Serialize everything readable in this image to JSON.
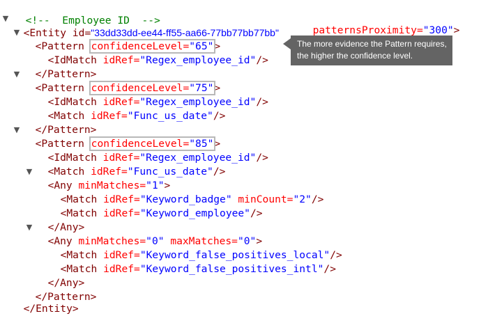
{
  "comment": "<!--  Employee ID  -->",
  "entity": {
    "open_prefix": "<Entity id=",
    "id_value": "\"33dd33dd-ee44-ff55-aa66-77bb77bb77bb\"",
    "proximity_attr": "patternsProximity=",
    "proximity_value": "\"300\"",
    "close": "</Entity>"
  },
  "tooltip": {
    "line1": "The more evidence the Pattern requires,",
    "line2": "the higher the confidence level."
  },
  "patterns": [
    {
      "open_tag": "<Pattern ",
      "conf_attr": "confidenceLevel=",
      "conf_value": "\"65\"",
      "open_close": ">",
      "lines": [
        {
          "tag": "<IdMatch ",
          "attr": "idRef=",
          "value": "\"Regex_employee_id\"",
          "end": "/>"
        }
      ],
      "close": "</Pattern>"
    },
    {
      "open_tag": "<Pattern ",
      "conf_attr": "confidenceLevel=",
      "conf_value": "\"75\"",
      "open_close": ">",
      "lines": [
        {
          "tag": "<IdMatch ",
          "attr": "idRef=",
          "value": "\"Regex_employee_id\"",
          "end": "/>"
        },
        {
          "tag": "<Match ",
          "attr": "idRef=",
          "value": "\"Func_us_date\"",
          "end": "/>"
        }
      ],
      "close": "</Pattern>"
    },
    {
      "open_tag": "<Pattern ",
      "conf_attr": "confidenceLevel=",
      "conf_value": "\"85\"",
      "open_close": ">",
      "lines": [
        {
          "tag": "<IdMatch ",
          "attr": "idRef=",
          "value": "\"Regex_employee_id\"",
          "end": "/>"
        },
        {
          "tag": "<Match ",
          "attr": "idRef=",
          "value": "\"Func_us_date\"",
          "end": "/>"
        }
      ],
      "any_blocks": [
        {
          "open_tag": "<Any ",
          "attr": "minMatches=",
          "value": "\"1\"",
          "attr2": "",
          "value2": "",
          "open_close": ">",
          "matches": [
            {
              "tag": "<Match ",
              "attr": "idRef=",
              "value": "\"Keyword_badge\"",
              "attr2": " minCount=",
              "value2": "\"2\"",
              "end": "/>"
            },
            {
              "tag": "<Match ",
              "attr": "idRef=",
              "value": "\"Keyword_employee\"",
              "attr2": "",
              "value2": "",
              "end": "/>"
            }
          ],
          "close": "</Any>"
        },
        {
          "open_tag": "<Any ",
          "attr": "minMatches=",
          "value": "\"0\"",
          "attr2": " maxMatches=",
          "value2": "\"0\"",
          "open_close": ">",
          "matches": [
            {
              "tag": "<Match ",
              "attr": "idRef=",
              "value": "\"Keyword_false_positives_local\"",
              "attr2": "",
              "value2": "",
              "end": "/>"
            },
            {
              "tag": "<Match ",
              "attr": "idRef=",
              "value": "\"Keyword_false_positives_intl\"",
              "attr2": "",
              "value2": "",
              "end": "/>"
            }
          ],
          "close": "</Any>"
        }
      ],
      "close": "</Pattern>"
    }
  ]
}
